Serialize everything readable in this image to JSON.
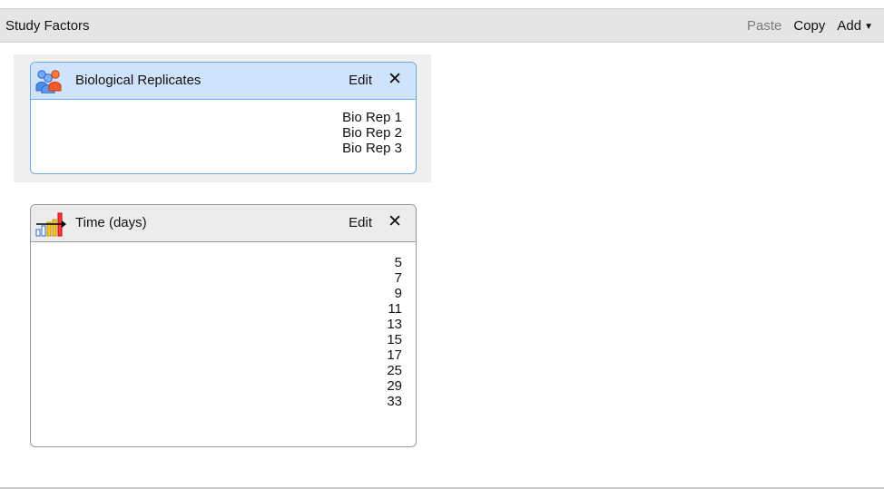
{
  "toolbar": {
    "title": "Study Factors",
    "paste_label": "Paste",
    "copy_label": "Copy",
    "add_label": "Add"
  },
  "factors": [
    {
      "title": "Biological Replicates",
      "icon": "people-icon",
      "edit_label": "Edit",
      "close_label": "✕",
      "values": [
        "Bio Rep 1",
        "Bio Rep 2",
        "Bio Rep 3"
      ],
      "selected": true
    },
    {
      "title": "Time (days)",
      "icon": "bar-chart-icon",
      "edit_label": "Edit",
      "close_label": "✕",
      "values": [
        "5",
        "7",
        "9",
        "11",
        "13",
        "15",
        "17",
        "25",
        "29",
        "33"
      ],
      "selected": false
    }
  ],
  "colors": {
    "selected_header": "#cfe3fb",
    "selected_border": "#6da7e6",
    "toolbar_background": "#e5e5e5"
  }
}
